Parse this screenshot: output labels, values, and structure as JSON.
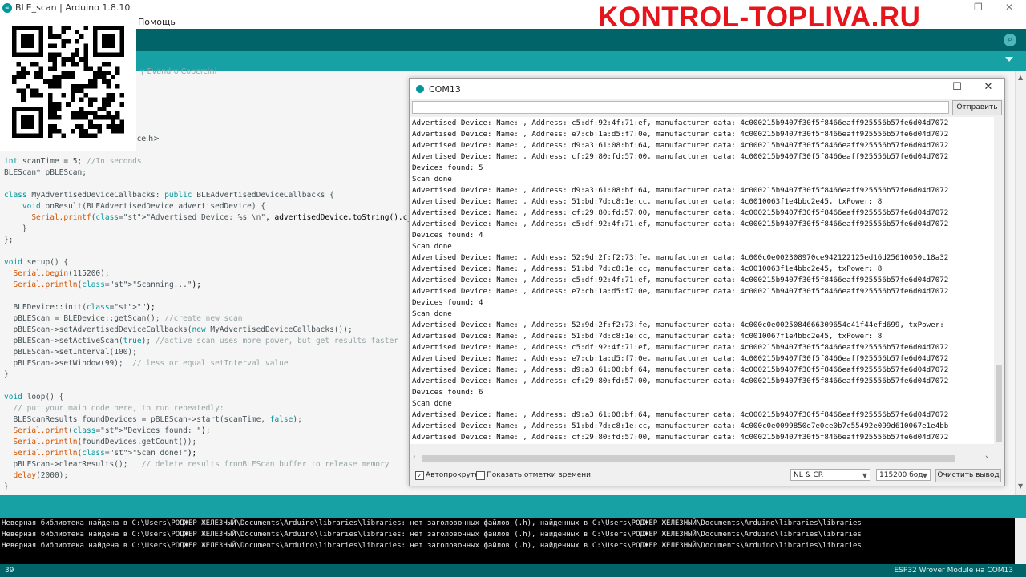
{
  "ide": {
    "window_title": "BLE_scan | Arduino 1.8.10",
    "app_icon_text": "∞",
    "menu": {
      "help": "Помощь"
    }
  },
  "watermark": {
    "text": "KONTROL-TOPLIVA.RU"
  },
  "colors": {
    "toolbar": "#006468",
    "tabbar": "#17a1a5",
    "watermark": "#e8141b"
  },
  "editor": {
    "partial_comment": "y Evandro Copercini",
    "include_tail": "ce.h>",
    "lines": [
      "int scanTime = 5; //In seconds",
      "BLEScan* pBLEScan;",
      "",
      "class MyAdvertisedDeviceCallbacks: public BLEAdvertisedDeviceCallbacks {",
      "    void onResult(BLEAdvertisedDevice advertisedDevice) {",
      "      Serial.printf(\"Advertised Device: %s \\n\", advertisedDevice.toString().c_str());",
      "    }",
      "};",
      "",
      "void setup() {",
      "  Serial.begin(115200);",
      "  Serial.println(\"Scanning...\");",
      "",
      "  BLEDevice::init(\"\");",
      "  pBLEScan = BLEDevice::getScan(); //create new scan",
      "  pBLEScan->setAdvertisedDeviceCallbacks(new MyAdvertisedDeviceCallbacks());",
      "  pBLEScan->setActiveScan(true); //active scan uses more power, but get results faster",
      "  pBLEScan->setInterval(100);",
      "  pBLEScan->setWindow(99);  // less or equal setInterval value",
      "}",
      "",
      "void loop() {",
      "  // put your main code here, to run repeatedly:",
      "  BLEScanResults foundDevices = pBLEScan->start(scanTime, false);",
      "  Serial.print(\"Devices found: \");",
      "  Serial.println(foundDevices.getCount());",
      "  Serial.println(\"Scan done!\");",
      "  pBLEScan->clearResults();   // delete results fromBLEScan buffer to release memory",
      "  delay(2000);",
      "}"
    ]
  },
  "console": {
    "lines": [
      "Неверная библиотека найдена в C:\\Users\\РОДЖЕР ЖЕЛЕЗНЫЙ\\Documents\\Arduino\\libraries\\libraries: нет заголовочных файлов (.h), найденных в C:\\Users\\РОДЖЕР ЖЕЛЕЗНЫЙ\\Documents\\Arduino\\libraries\\libraries",
      "Неверная библиотека найдена в C:\\Users\\РОДЖЕР ЖЕЛЕЗНЫЙ\\Documents\\Arduino\\libraries\\libraries: нет заголовочных файлов (.h), найденных в C:\\Users\\РОДЖЕР ЖЕЛЕЗНЫЙ\\Documents\\Arduino\\libraries\\libraries",
      "Неверная библиотека найдена в C:\\Users\\РОДЖЕР ЖЕЛЕЗНЫЙ\\Documents\\Arduino\\libraries\\libraries: нет заголовочных файлов (.h), найденных в C:\\Users\\РОДЖЕР ЖЕЛЕЗНЫЙ\\Documents\\Arduino\\libraries\\libraries"
    ]
  },
  "status": {
    "line_number": "39",
    "board": "ESP32 Wrover Module на COM13"
  },
  "serial_monitor": {
    "title": "COM13",
    "controls": {
      "minimize": "—",
      "maximize": "☐",
      "close": "✕"
    },
    "send_input_value": "",
    "send_label": "Отправить",
    "output_lines": [
      "Advertised Device: Name: , Address: c5:df:92:4f:71:ef, manufacturer data: 4c000215b9407f30f5f8466eaff925556b57fe6d04d7072",
      "Advertised Device: Name: , Address: e7:cb:1a:d5:f7:0e, manufacturer data: 4c000215b9407f30f5f8466eaff925556b57fe6d04d7072",
      "Advertised Device: Name: , Address: d9:a3:61:08:bf:64, manufacturer data: 4c000215b9407f30f5f8466eaff925556b57fe6d04d7072",
      "Advertised Device: Name: , Address: cf:29:80:fd:57:00, manufacturer data: 4c000215b9407f30f5f8466eaff925556b57fe6d04d7072",
      "Devices found: 5",
      "Scan done!",
      "Advertised Device: Name: , Address: d9:a3:61:08:bf:64, manufacturer data: 4c000215b9407f30f5f8466eaff925556b57fe6d04d7072",
      "Advertised Device: Name: , Address: 51:bd:7d:c8:1e:cc, manufacturer data: 4c0010063f1e4bbc2e45, txPower: 8",
      "Advertised Device: Name: , Address: cf:29:80:fd:57:00, manufacturer data: 4c000215b9407f30f5f8466eaff925556b57fe6d04d7072",
      "Advertised Device: Name: , Address: c5:df:92:4f:71:ef, manufacturer data: 4c000215b9407f30f5f8466eaff925556b57fe6d04d7072",
      "Devices found: 4",
      "Scan done!",
      "Advertised Device: Name: , Address: 52:9d:2f:f2:73:fe, manufacturer data: 4c000c0e002308970ce942122125ed16d25610050c18a32",
      "Advertised Device: Name: , Address: 51:bd:7d:c8:1e:cc, manufacturer data: 4c0010063f1e4bbc2e45, txPower: 8",
      "Advertised Device: Name: , Address: c5:df:92:4f:71:ef, manufacturer data: 4c000215b9407f30f5f8466eaff925556b57fe6d04d7072",
      "Advertised Device: Name: , Address: e7:cb:1a:d5:f7:0e, manufacturer data: 4c000215b9407f30f5f8466eaff925556b57fe6d04d7072",
      "Devices found: 4",
      "Scan done!",
      "Advertised Device: Name: , Address: 52:9d:2f:f2:73:fe, manufacturer data: 4c000c0e0025084666309654e41f44efd699, txPower:",
      "Advertised Device: Name: , Address: 51:bd:7d:c8:1e:cc, manufacturer data: 4c0010067f1e4bbc2e45, txPower: 8",
      "Advertised Device: Name: , Address: c5:df:92:4f:71:ef, manufacturer data: 4c000215b9407f30f5f8466eaff925556b57fe6d04d7072",
      "Advertised Device: Name: , Address: e7:cb:1a:d5:f7:0e, manufacturer data: 4c000215b9407f30f5f8466eaff925556b57fe6d04d7072",
      "Advertised Device: Name: , Address: d9:a3:61:08:bf:64, manufacturer data: 4c000215b9407f30f5f8466eaff925556b57fe6d04d7072",
      "Advertised Device: Name: , Address: cf:29:80:fd:57:00, manufacturer data: 4c000215b9407f30f5f8466eaff925556b57fe6d04d7072",
      "Devices found: 6",
      "Scan done!",
      "Advertised Device: Name: , Address: d9:a3:61:08:bf:64, manufacturer data: 4c000215b9407f30f5f8466eaff925556b57fe6d04d7072",
      "Advertised Device: Name: , Address: 51:bd:7d:c8:1e:cc, manufacturer data: 4c000c0e0099850e7e0ce0b7c55492e099d610067e1e4bb",
      "Advertised Device: Name: , Address: cf:29:80:fd:57:00, manufacturer data: 4c000215b9407f30f5f8466eaff925556b57fe6d04d7072"
    ],
    "autoscroll_label": "Автопрокрутка",
    "autoscroll_checked": "✓",
    "timestamps_label": "Показать отметки времени",
    "line_ending": "NL & CR",
    "baud_rate": "115200 бод",
    "clear_label": "Очистить вывод"
  }
}
